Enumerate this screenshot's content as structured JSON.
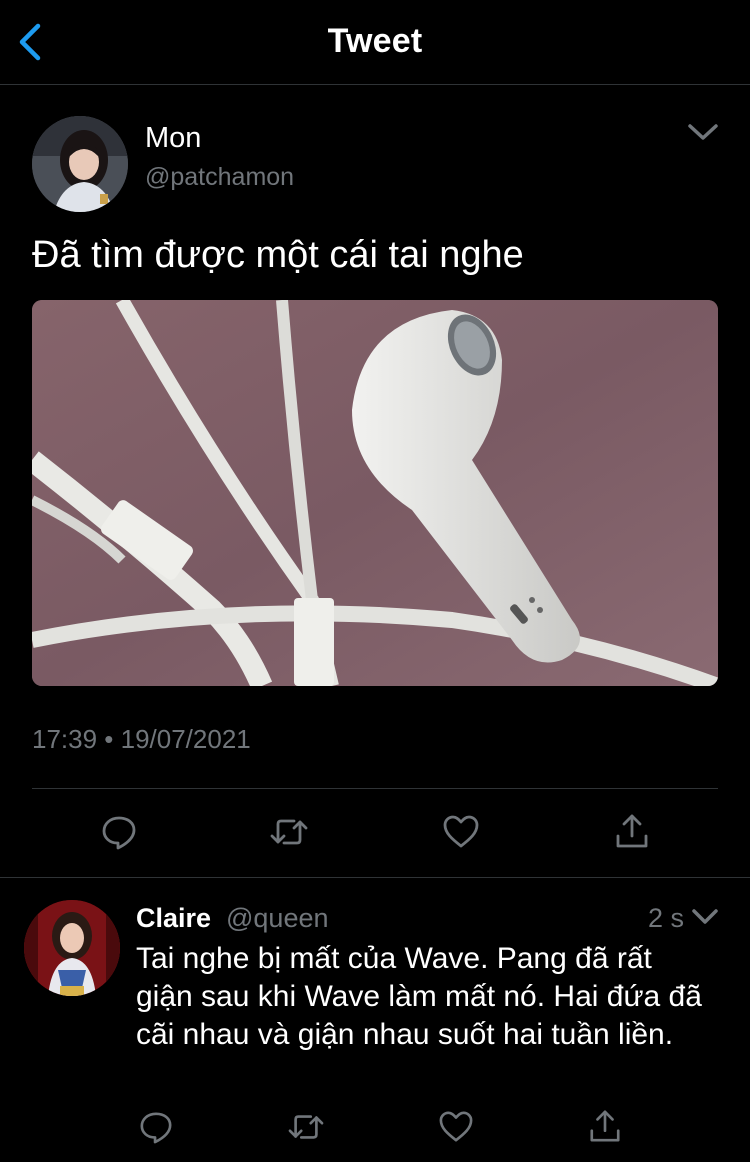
{
  "header": {
    "title": "Tweet"
  },
  "tweet": {
    "author_name": "Mon",
    "author_handle": "@patchamon",
    "text": "Đã tìm được một cái tai nghe",
    "timestamp": "17:39 • 19/07/2021",
    "media_description": "White wired earphone on pink textured surface"
  },
  "reply": {
    "author_name": "Claire",
    "author_handle": "@queen",
    "time": "2 s",
    "text": "Tai nghe bị mất của Wave. Pang đã rất giận sau khi Wave làm mất nó. Hai đứa đã cãi nhau và giận nhau suốt hai tuần liền."
  },
  "colors": {
    "background": "#000000",
    "accent": "#1d9bf0",
    "muted": "#71767b",
    "divider": "#2f3336"
  },
  "icons": [
    "back-arrow-icon",
    "chevron-down-icon",
    "reply-icon",
    "retweet-icon",
    "like-icon",
    "share-icon"
  ]
}
